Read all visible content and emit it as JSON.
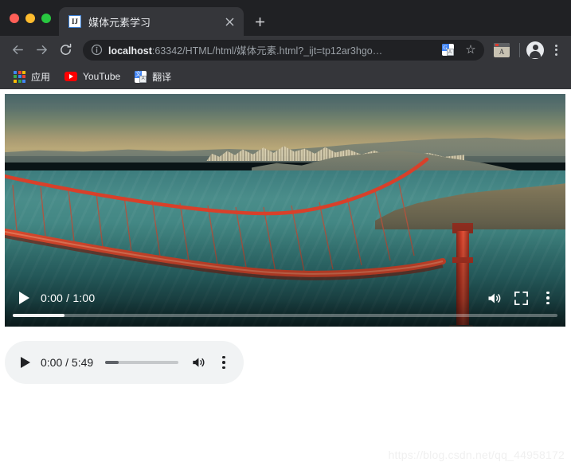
{
  "window": {
    "controls": [
      {
        "name": "close",
        "color": "#ff5f57"
      },
      {
        "name": "minimize",
        "color": "#febc2e"
      },
      {
        "name": "maximize",
        "color": "#28c840"
      }
    ]
  },
  "tab": {
    "title": "媒体元素学习",
    "favicon_text": "IJ",
    "close_glyph": "✕",
    "newtab_glyph": "+"
  },
  "toolbar": {
    "back_glyph": "←",
    "forward_glyph": "→",
    "reload_glyph": "⟳",
    "info_glyph": "ⓘ",
    "url_host": "localhost",
    "url_rest": ":63342/HTML/html/媒体元素.html?_ijt=tp12ar3hgo…",
    "translate_icon_label": "G",
    "star_glyph": "☆",
    "extension_letter": "A"
  },
  "bookmarks": [
    {
      "label": "应用",
      "icon": "apps-grid-icon"
    },
    {
      "label": "YouTube",
      "icon": "youtube-icon"
    },
    {
      "label": "翻译",
      "icon": "google-translate-icon"
    }
  ],
  "video_player": {
    "current_time": "0:00",
    "duration": "1:00",
    "time_display": "0:00 / 1:00",
    "buffered_percent": 9.5,
    "played_percent": 0,
    "play_label": "play",
    "volume_label": "mute",
    "fullscreen_label": "full screen",
    "more_label": "more options"
  },
  "audio_player": {
    "current_time": "0:00",
    "duration": "5:49",
    "time_display": "0:00 / 5:49",
    "progress_percent": 18,
    "play_label": "play",
    "volume_label": "mute",
    "more_label": "more options"
  },
  "watermark": {
    "text": "https://blog.csdn.net/qq_44958172"
  },
  "colors": {
    "chrome_dark": "#35363a",
    "tabstrip": "#202124",
    "omnibox": "#202124",
    "audio_bg": "#f1f3f4",
    "accent_blue": "#3b7fd4",
    "youtube_red": "#ff0000"
  }
}
